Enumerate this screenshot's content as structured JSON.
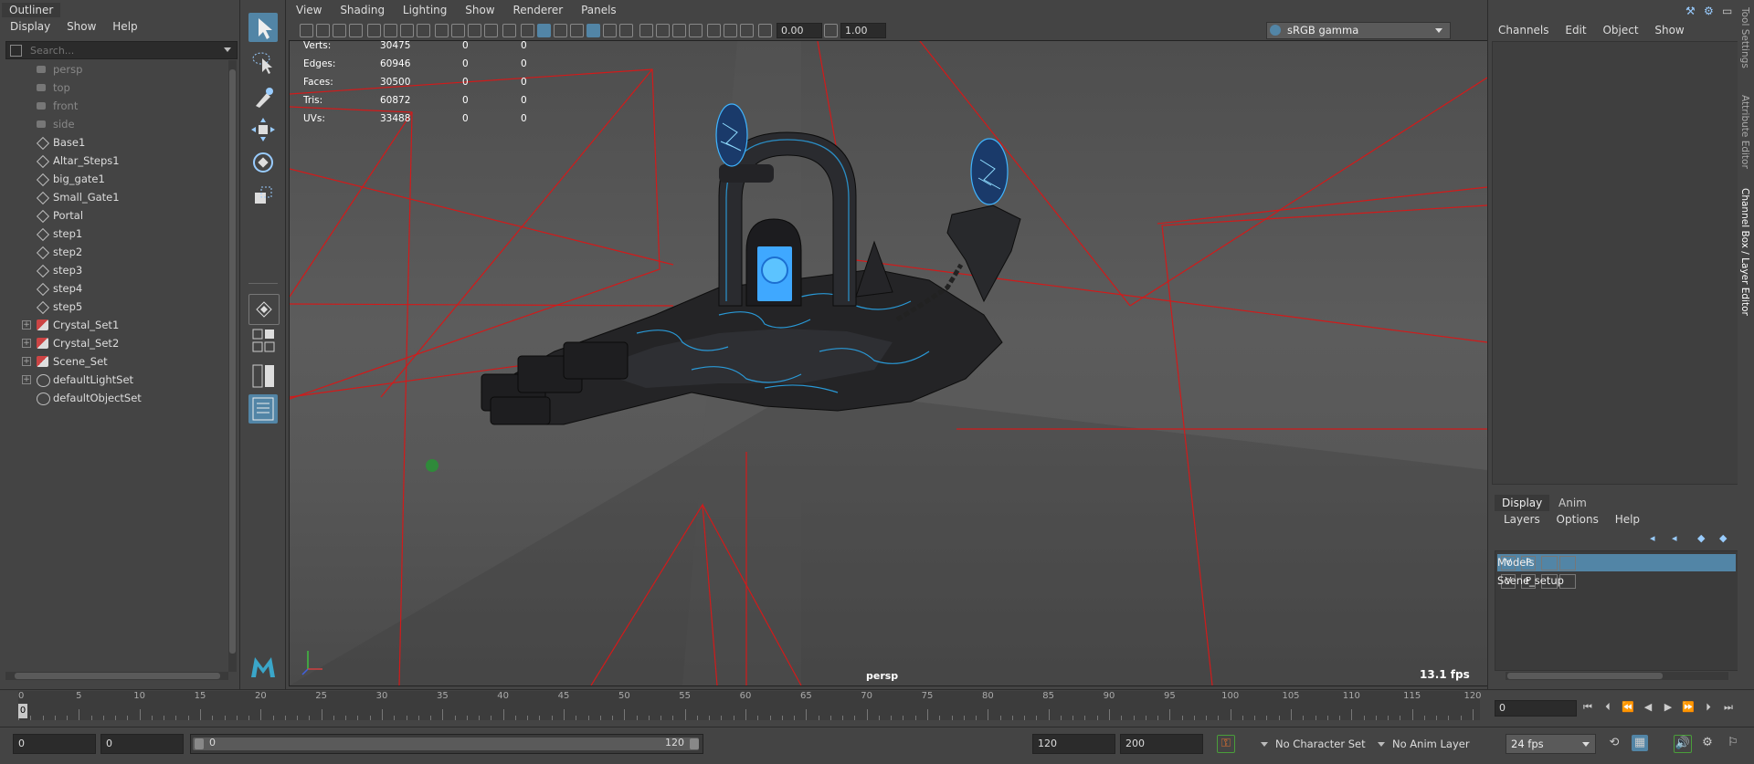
{
  "outliner": {
    "title": "Outliner",
    "menu": [
      "Display",
      "Show",
      "Help"
    ],
    "search_placeholder": "Search...",
    "items": [
      {
        "label": "persp",
        "kind": "camera",
        "dim": true
      },
      {
        "label": "top",
        "kind": "camera",
        "dim": true
      },
      {
        "label": "front",
        "kind": "camera",
        "dim": true
      },
      {
        "label": "side",
        "kind": "camera",
        "dim": true
      },
      {
        "label": "Base1",
        "kind": "mesh"
      },
      {
        "label": "Altar_Steps1",
        "kind": "mesh"
      },
      {
        "label": "big_gate1",
        "kind": "mesh"
      },
      {
        "label": "Small_Gate1",
        "kind": "mesh"
      },
      {
        "label": "Portal",
        "kind": "mesh"
      },
      {
        "label": "step1",
        "kind": "mesh"
      },
      {
        "label": "step2",
        "kind": "mesh"
      },
      {
        "label": "step3",
        "kind": "mesh"
      },
      {
        "label": "step4",
        "kind": "mesh"
      },
      {
        "label": "step5",
        "kind": "mesh"
      },
      {
        "label": "Crystal_Set1",
        "kind": "set",
        "expandable": true
      },
      {
        "label": "Crystal_Set2",
        "kind": "set",
        "expandable": true
      },
      {
        "label": "Scene_Set",
        "kind": "set",
        "expandable": true
      },
      {
        "label": "defaultLightSet",
        "kind": "lightset",
        "expandable": true
      },
      {
        "label": "defaultObjectSet",
        "kind": "lightset"
      }
    ]
  },
  "viewport": {
    "menu": [
      "View",
      "Shading",
      "Lighting",
      "Show",
      "Renderer",
      "Panels"
    ],
    "exposure": "0.00",
    "gamma": "1.00",
    "color_space": "sRGB gamma",
    "camera": "persp",
    "fps": "13.1 fps",
    "hud": [
      {
        "label": "Verts:",
        "v1": "30475",
        "v2": "0",
        "v3": "0"
      },
      {
        "label": "Edges:",
        "v1": "60946",
        "v2": "0",
        "v3": "0"
      },
      {
        "label": "Faces:",
        "v1": "30500",
        "v2": "0",
        "v3": "0"
      },
      {
        "label": "Tris:",
        "v1": "60872",
        "v2": "0",
        "v3": "0"
      },
      {
        "label": "UVs:",
        "v1": "33488",
        "v2": "0",
        "v3": "0"
      }
    ]
  },
  "channel_box": {
    "menu": [
      "Channels",
      "Edit",
      "Object",
      "Show"
    ]
  },
  "layer_editor": {
    "tabs": [
      "Display",
      "Anim"
    ],
    "menu": [
      "Layers",
      "Options",
      "Help"
    ],
    "layers": [
      {
        "v": "V",
        "p": "P",
        "name": "Models",
        "selected": true
      },
      {
        "v": "V",
        "p": "P",
        "name": "Scene_setup",
        "selected": false
      }
    ]
  },
  "side_tabs": [
    "Tool Settings",
    "Attribute Editor",
    "Channel Box / Layer Editor"
  ],
  "timeline": {
    "ticks": [
      "0",
      "5",
      "10",
      "15",
      "20",
      "25",
      "30",
      "35",
      "40",
      "45",
      "50",
      "55",
      "60",
      "65",
      "70",
      "75",
      "80",
      "85",
      "90",
      "95",
      "100",
      "105",
      "110",
      "115",
      "120"
    ],
    "current_frame_marker": "0",
    "current_frame": "0"
  },
  "range": {
    "start": "0",
    "playback_start": "0",
    "slider_start": "0",
    "slider_end": "120",
    "playback_end": "120",
    "end": "200",
    "character_set": "No Character Set",
    "anim_layer": "No Anim Layer",
    "fps": "24 fps"
  },
  "colors": {
    "accent": "#5285a6",
    "grid_line": "#d21a1a",
    "portal_glow": "#3fa8ff"
  }
}
